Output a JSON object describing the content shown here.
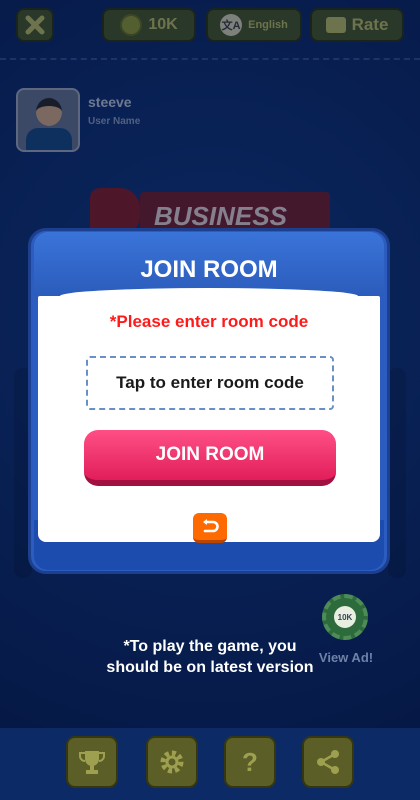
{
  "topbar": {
    "coins": "10K",
    "language": "English",
    "rate": "Rate"
  },
  "user": {
    "name": "steeve",
    "label": "User Name"
  },
  "logo": {
    "text": "BUSINESS"
  },
  "modal": {
    "title": "JOIN ROOM",
    "error": "*Please enter room code",
    "input_placeholder": "Tap to enter room code",
    "join_button": "JOIN ROOM"
  },
  "version_note": {
    "line1": "*To play the game, you",
    "line2": "should be on latest version"
  },
  "view_ad": {
    "chip_value": "10K",
    "label": "View Ad!"
  },
  "icons": {
    "close": "close-icon",
    "coin": "coin-icon",
    "language": "translate-icon",
    "rate": "thumbs-up-icon",
    "back": "undo-icon",
    "leaderboard": "trophy-icon",
    "settings": "gear-icon",
    "help": "question-icon",
    "share": "share-icon"
  },
  "colors": {
    "modal_frame": "#2c5cc0",
    "join_button": "#ff3d76",
    "error_text": "#ff1a1a",
    "back_button": "#ff6a00"
  }
}
